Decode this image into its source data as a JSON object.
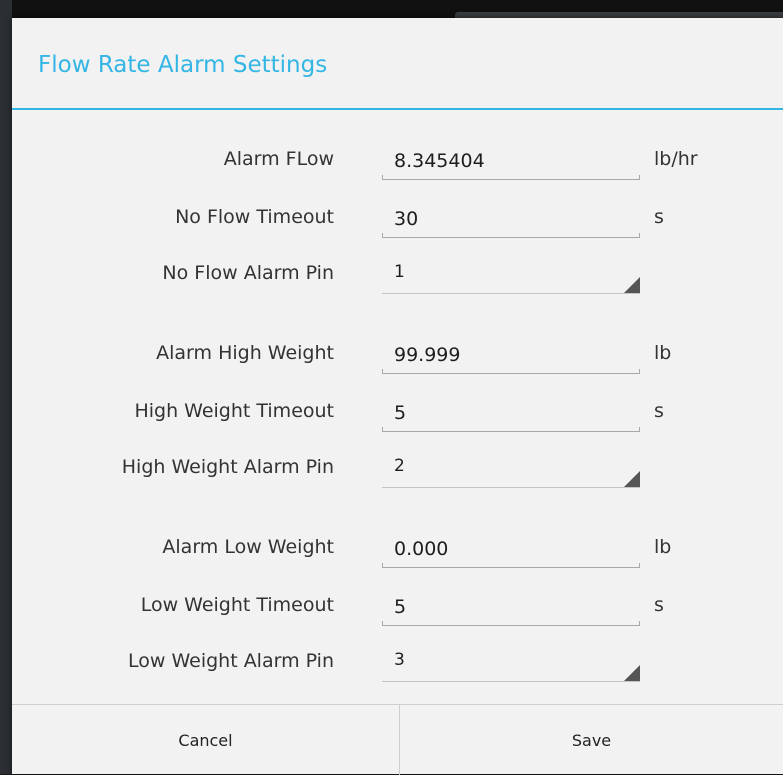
{
  "dialog": {
    "title": "Flow Rate Alarm Settings",
    "accent_color": "#33b5e5"
  },
  "rows": [
    {
      "label": "Alarm FLow",
      "value": "8.345404",
      "unit": "lb/hr",
      "kind": "text"
    },
    {
      "label": "No Flow Timeout",
      "value": "30",
      "unit": "s",
      "kind": "text"
    },
    {
      "label": "No Flow Alarm Pin",
      "value": "1",
      "kind": "spinner"
    },
    {
      "label": "Alarm High Weight",
      "value": "99.999",
      "unit": "lb",
      "kind": "text"
    },
    {
      "label": "High Weight Timeout",
      "value": "5",
      "unit": "s",
      "kind": "text"
    },
    {
      "label": "High Weight Alarm Pin",
      "value": "2",
      "kind": "spinner"
    },
    {
      "label": "Alarm Low Weight",
      "value": "0.000",
      "unit": "lb",
      "kind": "text"
    },
    {
      "label": "Low Weight Timeout",
      "value": "5",
      "unit": "s",
      "kind": "text"
    },
    {
      "label": "Low Weight Alarm Pin",
      "value": "3",
      "kind": "spinner"
    }
  ],
  "buttons": {
    "cancel": "Cancel",
    "save": "Save"
  }
}
